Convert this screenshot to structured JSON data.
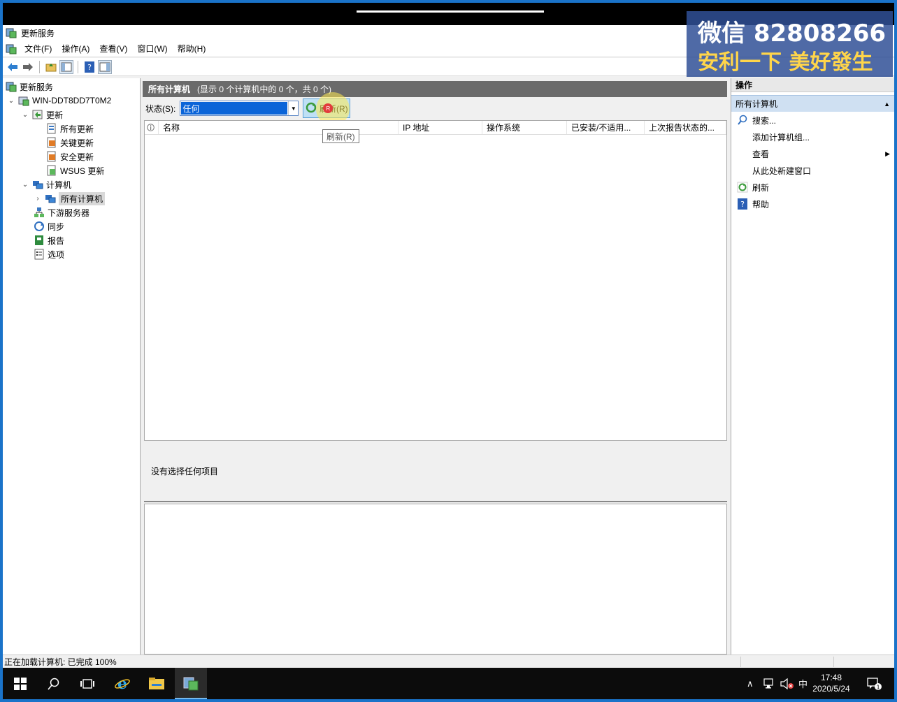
{
  "window": {
    "title": "更新服务"
  },
  "menu": [
    "文件(F)",
    "操作(A)",
    "查看(V)",
    "窗口(W)",
    "帮助(H)"
  ],
  "tree": {
    "root": "更新服务",
    "server": "WIN-DDT8DD7T0M2",
    "updates": "更新",
    "all_updates": "所有更新",
    "critical_updates": "关键更新",
    "security_updates": "安全更新",
    "wsus_updates": "WSUS 更新",
    "computers": "计算机",
    "all_computers": "所有计算机",
    "downstream": "下游服务器",
    "sync": "同步",
    "reports": "报告",
    "options": "选项"
  },
  "center": {
    "header_title": "所有计算机",
    "header_info": "(显示 0 个计算机中的 0 个，共 0 个)",
    "status_label": "状态(S):",
    "status_value": "任何",
    "refresh_button": "刷新(R)",
    "tooltip": "刷新(R)",
    "columns": [
      "名称",
      "IP 地址",
      "操作系统",
      "已安装/不适用...",
      "上次报告状态的..."
    ],
    "details_text": "没有选择任何项目"
  },
  "actions": {
    "header": "操作",
    "section": "所有计算机",
    "items": [
      "搜索...",
      "添加计算机组...",
      "查看",
      "从此处新建窗口",
      "刷新",
      "帮助"
    ]
  },
  "status": {
    "text": "正在加载计算机: 已完成 100%"
  },
  "taskbar": {
    "time": "17:48",
    "date": "2020/5/24",
    "ime": "中",
    "notify_count": "1"
  },
  "watermark": {
    "line1": "微信 82808266",
    "line2": "安利一下 美好發生"
  }
}
